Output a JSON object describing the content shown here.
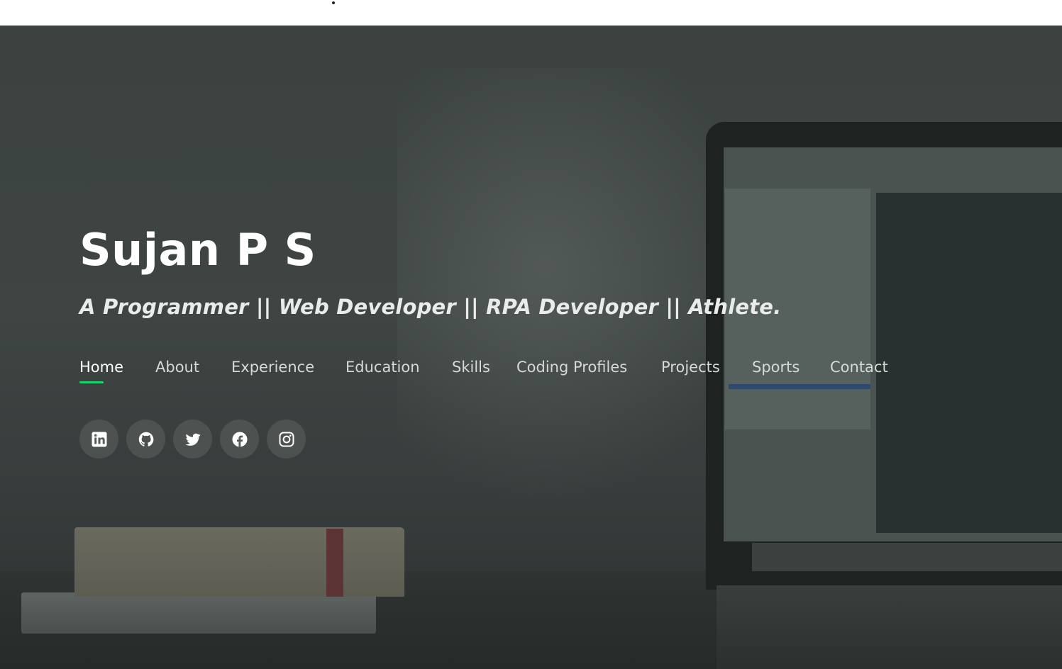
{
  "hero": {
    "name": "Sujan P S",
    "tagline": "A Programmer || Web Developer || RPA Developer || Athlete."
  },
  "nav": {
    "items": [
      {
        "label": "Home",
        "active": true
      },
      {
        "label": "About",
        "active": false
      },
      {
        "label": "Experience",
        "active": false
      },
      {
        "label": "Education",
        "active": false
      },
      {
        "label": "Skills",
        "active": false
      },
      {
        "label": "Coding Profiles",
        "active": false
      },
      {
        "label": "Projects",
        "active": false
      },
      {
        "label": "Sports",
        "active": false
      },
      {
        "label": "Contact",
        "active": false
      }
    ]
  },
  "social": [
    {
      "icon": "linkedin-icon"
    },
    {
      "icon": "github-icon"
    },
    {
      "icon": "twitter-icon"
    },
    {
      "icon": "facebook-icon"
    },
    {
      "icon": "instagram-icon"
    }
  ],
  "colors": {
    "accent": "#18d26e",
    "overlay": "#3c4341",
    "text": "#ffffff"
  }
}
